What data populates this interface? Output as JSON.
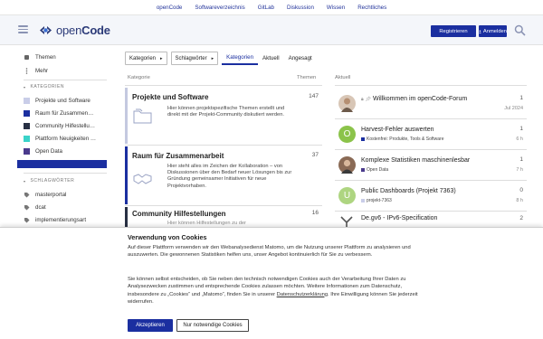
{
  "topnav": {
    "items": [
      "openCode",
      "Softwareverzeichnis",
      "GitLab",
      "Diskussion",
      "Wissen",
      "Rechtliches"
    ]
  },
  "header": {
    "logo_light": "open",
    "logo_bold": "Code",
    "register_label": "Registrieren",
    "login_label": "Anmelden"
  },
  "sidebar": {
    "themen": "Themen",
    "mehr": "Mehr",
    "categories_heading": "KATEGORIEN",
    "categories": [
      {
        "label": "Projekte und Software",
        "color": "#c9cde8"
      },
      {
        "label": "Raum für Zusammen…",
        "color": "#1b2fa0"
      },
      {
        "label": "Community Hilfestellu…",
        "color": "#283044"
      },
      {
        "label": "Plattform Neuigkeiten …",
        "color": "#3ad3c9"
      },
      {
        "label": "Open Data",
        "color": "#4a3a8c"
      }
    ],
    "tags_heading": "SCHLAGWÖRTER",
    "tags": [
      "masterportal",
      "dcat",
      "implementierungsart"
    ]
  },
  "nav": {
    "categories_dropdown": "Kategorien",
    "tags_dropdown": "Schlagwörter",
    "tabs": [
      "Kategorien",
      "Aktuell",
      "Angesagt"
    ],
    "active_tab": "Kategorien"
  },
  "categories_table": {
    "col_category": "Kategorie",
    "col_topics": "Themen",
    "rows": [
      {
        "title": "Projekte und Software",
        "count": "147",
        "description": "Hier können projektspezifische Themen erstellt und direkt mit der Projekt-Community diskutiert werden."
      },
      {
        "title": "Raum für Zusammenarbeit",
        "count": "37",
        "description": "Hier steht alles im Zeichen der Kollaboration – von Diskussionen über den Bedarf neuer Lösungen bis zur Gründung gemeinsamer Initiativen für neue Projektvorhaben."
      },
      {
        "title": "Community Hilfestellungen",
        "count": "16",
        "description": "Hier können Hilfestellungen zu der"
      }
    ]
  },
  "latest": {
    "heading": "Aktuell",
    "items": [
      {
        "title": "Willkommen im openCode-Forum",
        "category": "",
        "count": "1",
        "time": "Jul 2024",
        "avatar_letter": "",
        "avatar_color": "#c9b8a8",
        "pinned": true
      },
      {
        "title": "Harvest-Fehler auswerten",
        "category": "Kostenfrei: Produkte, Tools & Software",
        "cat_color": "#1b2fa0",
        "count": "1",
        "time": "6 h",
        "avatar_letter": "O",
        "avatar_color": "#8bc34a"
      },
      {
        "title": "Komplexe Statistiken maschinenlesbar",
        "category": "Open Data",
        "cat_color": "#4a3a8c",
        "count": "1",
        "time": "7 h",
        "avatar_letter": "",
        "avatar_color": "#7a5a48"
      },
      {
        "title": "Public Dashboards (Projekt 7363)",
        "category": "projekt-7363",
        "cat_color": "#c9cde8",
        "count": "0",
        "time": "8 h",
        "avatar_letter": "U",
        "avatar_color": "#aed581"
      },
      {
        "title": "De.gv6 - IPv6-Specification",
        "category": "",
        "count": "2",
        "time": "",
        "avatar_letter": "",
        "avatar_color": "#666"
      }
    ]
  },
  "cookie": {
    "title": "Verwendung von Cookies",
    "p1": "Auf dieser Plattform verwenden wir den Webanalysedienst Matomo, um die Nutzung unserer Plattform zu analysieren und auszuwerten. Die gewonnenen Statistiken helfen uns, unser Angebot kontinuierlich für Sie zu verbessern.",
    "p2_before": "Sie können selbst entscheiden, ob Sie neben den technisch notwendigen Cookies auch der Verarbeitung Ihrer Daten zu Analysezwecken zustimmen und entsprechende Cookies zulassen möchten. Weitere Informationen zum Datenschutz, insbesondere zu „Cookies“ und „Matomo“, finden Sie in unserer ",
    "p2_link": "Datenschutzerklärung",
    "p2_after": ". Ihre Einwilligung können Sie jederzeit widerrufen.",
    "accept_label": "Akzeptieren",
    "necessary_label": "Nur notwendige Cookies"
  }
}
